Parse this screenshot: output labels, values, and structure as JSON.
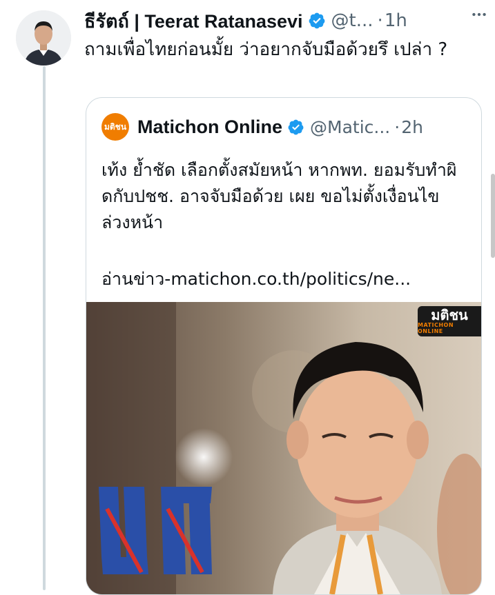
{
  "tweet": {
    "author_name": "ธีรัตถ์ | Teerat Ratanasevi",
    "handle": "@t...",
    "separator": "·",
    "time": "1h",
    "text": "ถามเพื่อไทยก่อนมั้ย ว่าอยากจับมือด้วยรึ เปล่า ?"
  },
  "quote": {
    "author_name": "Matichon Online",
    "handle": "@Matic...",
    "separator": "·",
    "time": "2h",
    "text": "เท้ง ย้ำชัด เลือกตั้งสมัยหน้า หากพท. ยอมรับทำผิดกับปชช. อาจจับมือด้วย เผย ขอไม่ตั้งเงื่อนไขล่วงหน้า",
    "link": "อ่านข่าว-matichon.co.th/politics/ne...",
    "logo_text": "มติชน",
    "media": {
      "watermark_main": "มติชน",
      "watermark_sub": "MATICHON ONLINE",
      "party_letters": "พท"
    }
  },
  "colors": {
    "verified": "#1d9bf0",
    "secondary_text": "#536471",
    "border": "#cfd9de",
    "matichon_orange": "#f07d00",
    "party_blue": "#2a4fa8",
    "party_red": "#d8322b"
  },
  "icons": {
    "verified": "verified-badge-icon",
    "more": "more-options-icon"
  }
}
